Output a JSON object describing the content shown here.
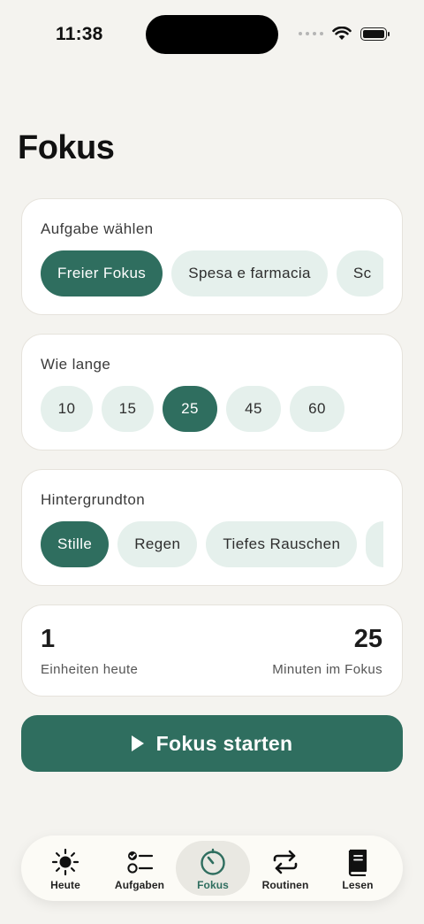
{
  "status_bar": {
    "time": "11:38"
  },
  "page_title": "Fokus",
  "task_card": {
    "title": "Aufgabe wählen",
    "options": [
      "Freier Fokus",
      "Spesa e farmacia",
      "Sc"
    ],
    "selected_index": 0
  },
  "duration_card": {
    "title": "Wie lange",
    "options": [
      "10",
      "15",
      "25",
      "45",
      "60"
    ],
    "selected_index": 2
  },
  "sound_card": {
    "title": "Hintergrundton",
    "options": [
      "Stille",
      "Regen",
      "Tiefes Rauschen",
      ""
    ],
    "selected_index": 0
  },
  "stats": {
    "units_value": "1",
    "units_label": "Einheiten heute",
    "minutes_value": "25",
    "minutes_label": "Minuten im Fokus"
  },
  "start_button": {
    "label": "Fokus starten",
    "icon": "play-icon"
  },
  "tabbar": {
    "items": [
      {
        "label": "Heute",
        "icon": "sun-icon"
      },
      {
        "label": "Aufgaben",
        "icon": "checklist-icon"
      },
      {
        "label": "Fokus",
        "icon": "timer-icon"
      },
      {
        "label": "Routinen",
        "icon": "repeat-icon"
      },
      {
        "label": "Lesen",
        "icon": "book-icon"
      }
    ],
    "active_index": 2
  },
  "colors": {
    "accent": "#2f6e5f",
    "chip_inactive": "#e5f0ec",
    "background": "#f4f3ef"
  }
}
